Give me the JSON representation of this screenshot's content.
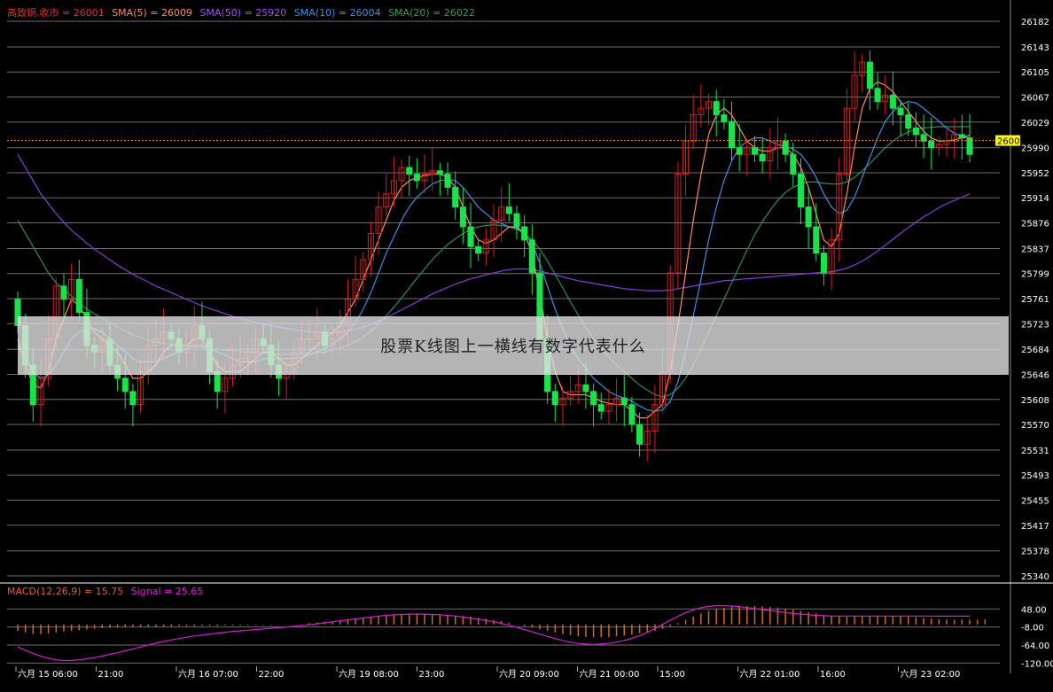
{
  "colors": {
    "background": "#000000",
    "grid": "#6e6e6e",
    "up": "#d42020",
    "down": "#19e34a",
    "sma5": "#ff8c5a",
    "sma10": "#3b8fe6",
    "sma20": "#2a8f5a",
    "sma50": "#8a3ad9",
    "last_price_line": "#ff8c00",
    "macd_hist": "#d2691e",
    "signal": "#d21fd2",
    "last_price_tag_bg": "#ffff00"
  },
  "header": {
    "price_label": "高致铜.收市 = 26001",
    "sma5_label": "SMA(5) = 26009",
    "sma50_label": "SMA(50) = 25920",
    "sma10_label": "SMA(10) = 26004",
    "sma20_label": "SMA(20) = 26022"
  },
  "macd_header": {
    "macd_label": "MACD(12,26,9) = 15.75",
    "signal_label": "Signal = 25.65"
  },
  "banner": {
    "text": "股票K线图上一横线有数字代表什么"
  },
  "chart_data": {
    "type": "candlestick",
    "y_ticks": [
      26182,
      26143,
      26105,
      26067,
      26029,
      25990,
      25952,
      25914,
      25876,
      25837,
      25799,
      25761,
      25723,
      25684,
      25646,
      25608,
      25570,
      25531,
      25493,
      25455,
      25417,
      25378,
      25340
    ],
    "ylim": [
      25340,
      26182
    ],
    "last_price": 26001,
    "x_tick_labels": [
      "六月 15 06:00",
      "21:00",
      "六月 16 07:00",
      "22:00",
      "六月 19 08:00",
      "23:00",
      "六月 20 09:00",
      "六月 21 00:00",
      "15:00",
      "六月 22 01:00",
      "16:00",
      "六月 23 02:00"
    ],
    "closes": [
      25720,
      25660,
      25600,
      25640,
      25700,
      25780,
      25760,
      25790,
      25740,
      25690,
      25680,
      25700,
      25660,
      25640,
      25620,
      25600,
      25650,
      25690,
      25700,
      25710,
      25700,
      25680,
      25690,
      25720,
      25700,
      25650,
      25620,
      25640,
      25660,
      25670,
      25680,
      25700,
      25690,
      25660,
      25640,
      25650,
      25680,
      25700,
      25700,
      25710,
      25690,
      25700,
      25720,
      25760,
      25790,
      25820,
      25860,
      25900,
      25920,
      25940,
      25960,
      25950,
      25940,
      25950,
      25955,
      25950,
      25930,
      25900,
      25870,
      25840,
      25830,
      25850,
      25880,
      25900,
      25890,
      25870,
      25850,
      25800,
      25700,
      25620,
      25600,
      25610,
      25620,
      25630,
      25620,
      25600,
      25590,
      25600,
      25610,
      25600,
      25570,
      25540,
      25560,
      25600,
      25650,
      25800,
      25950,
      26000,
      26040,
      26050,
      26060,
      26040,
      26030,
      25990,
      25980,
      25990,
      25980,
      25970,
      25990,
      26000,
      25980,
      25950,
      25900,
      25870,
      25830,
      25800,
      25850,
      25950,
      26050,
      26100,
      26120,
      26080,
      26060,
      26070,
      26050,
      26040,
      26020,
      26010,
      26000,
      25990,
      25995,
      26000,
      26010,
      26005,
      25980
    ],
    "sma5": [
      25700,
      25660,
      25630,
      25625,
      25650,
      25700,
      25730,
      25760,
      25750,
      25730,
      25710,
      25700,
      25690,
      25680,
      25660,
      25640,
      25640,
      25650,
      25660,
      25680,
      25690,
      25690,
      25690,
      25700,
      25700,
      25680,
      25660,
      25650,
      25650,
      25650,
      25660,
      25670,
      25680,
      25680,
      25670,
      25660,
      25660,
      25670,
      25680,
      25690,
      25700,
      25710,
      25720,
      25740,
      25760,
      25790,
      25820,
      25850,
      25880,
      25910,
      25930,
      25940,
      25945,
      25948,
      25950,
      25950,
      25945,
      25930,
      25900,
      25870,
      25850,
      25845,
      25850,
      25860,
      25870,
      25870,
      25860,
      25830,
      25770,
      25700,
      25650,
      25620,
      25615,
      25615,
      25615,
      25610,
      25605,
      25602,
      25600,
      25600,
      25590,
      25580,
      25580,
      25590,
      25600,
      25650,
      25720,
      25800,
      25880,
      25950,
      26010,
      26040,
      26050,
      26040,
      26020,
      26000,
      25990,
      25985,
      25985,
      25990,
      25990,
      25980,
      25960,
      25930,
      25890,
      25850,
      25840,
      25860,
      25920,
      25990,
      26050,
      26080,
      26090,
      26085,
      26075,
      26060,
      26045,
      26030,
      26015,
      26005,
      26000,
      26000,
      26002,
      26005,
      26009
    ],
    "sma10": [
      25690,
      25670,
      25650,
      25640,
      25645,
      25660,
      25680,
      25700,
      25710,
      25715,
      25715,
      25710,
      25700,
      25690,
      25680,
      25670,
      25665,
      25665,
      25665,
      25670,
      25675,
      25680,
      25685,
      25690,
      25690,
      25685,
      25680,
      25675,
      25670,
      25665,
      25665,
      25665,
      25670,
      25670,
      25670,
      25670,
      25670,
      25672,
      25675,
      25680,
      25685,
      25692,
      25700,
      25710,
      25725,
      25745,
      25770,
      25800,
      25830,
      25855,
      25880,
      25900,
      25915,
      25925,
      25935,
      25940,
      25942,
      25940,
      25930,
      25915,
      25900,
      25890,
      25880,
      25875,
      25870,
      25868,
      25860,
      25845,
      25815,
      25780,
      25745,
      25715,
      25690,
      25670,
      25655,
      25640,
      25630,
      25620,
      25614,
      25610,
      25605,
      25598,
      25592,
      25590,
      25592,
      25605,
      25635,
      25680,
      25735,
      25790,
      25850,
      25900,
      25940,
      25970,
      25990,
      26000,
      26005,
      26005,
      26000,
      25995,
      25992,
      25988,
      25980,
      25965,
      25945,
      25920,
      25900,
      25890,
      25895,
      25915,
      25945,
      25975,
      26005,
      26030,
      26045,
      26055,
      26060,
      26058,
      26050,
      26040,
      26030,
      26020,
      26012,
      26008,
      26004
    ],
    "sma20": [
      25880,
      25860,
      25840,
      25820,
      25800,
      25785,
      25775,
      25765,
      25755,
      25745,
      25738,
      25731,
      25725,
      25718,
      25712,
      25706,
      25702,
      25698,
      25695,
      25693,
      25692,
      25690,
      25689,
      25688,
      25687,
      25685,
      25684,
      25683,
      25682,
      25681,
      25680,
      25679,
      25679,
      25678,
      25677,
      25677,
      25677,
      25677,
      25678,
      25679,
      25680,
      25683,
      25686,
      25690,
      25696,
      25703,
      25712,
      25723,
      25735,
      25748,
      25762,
      25777,
      25792,
      25806,
      25820,
      25832,
      25843,
      25852,
      25860,
      25866,
      25870,
      25872,
      25873,
      25872,
      25870,
      25866,
      25860,
      25850,
      25836,
      25818,
      25798,
      25777,
      25756,
      25736,
      25717,
      25700,
      25685,
      25672,
      25660,
      25650,
      25640,
      25630,
      25622,
      25615,
      25612,
      25615,
      25625,
      25640,
      25660,
      25685,
      25710,
      25735,
      25760,
      25785,
      25810,
      25835,
      25858,
      25878,
      25895,
      25910,
      25922,
      25930,
      25935,
      25938,
      25938,
      25936,
      25935,
      25935,
      25938,
      25945,
      25955,
      25966,
      25978,
      25990,
      26000,
      26008,
      26014,
      26018,
      26020,
      26021,
      26022,
      26022,
      26022,
      26022,
      26022
    ],
    "sma50": [
      25980,
      25960,
      25940,
      25920,
      25905,
      25890,
      25877,
      25865,
      25855,
      25845,
      25836,
      25828,
      25820,
      25812,
      25805,
      25798,
      25792,
      25786,
      25780,
      25775,
      25770,
      25765,
      25760,
      25755,
      25750,
      25746,
      25742,
      25738,
      25734,
      25731,
      25728,
      25725,
      25722,
      25720,
      25718,
      25716,
      25714,
      25712,
      25711,
      25710,
      25709,
      25709,
      25710,
      25712,
      25715,
      25718,
      25722,
      25727,
      25732,
      25738,
      25744,
      25750,
      25756,
      25762,
      25768,
      25773,
      25778,
      25783,
      25787,
      25791,
      25794,
      25797,
      25800,
      25803,
      25805,
      25806,
      25806,
      25805,
      25803,
      25800,
      25797,
      25794,
      25791,
      25788,
      25786,
      25784,
      25782,
      25780,
      25778,
      25776,
      25775,
      25774,
      25773,
      25773,
      25773,
      25774,
      25776,
      25778,
      25780,
      25782,
      25784,
      25786,
      25788,
      25789,
      25790,
      25791,
      25792,
      25793,
      25794,
      25795,
      25796,
      25797,
      25798,
      25799,
      25800,
      25801,
      25802,
      25804,
      25807,
      25812,
      25818,
      25825,
      25833,
      25842,
      25851,
      25860,
      25869,
      25877,
      25885,
      25892,
      25899,
      25905,
      25910,
      25915,
      25920
    ],
    "macd_hist": [
      -20,
      -25,
      -30,
      -30,
      -28,
      -25,
      -22,
      -20,
      -18,
      -16,
      -14,
      -12,
      -11,
      -10,
      -9,
      -8,
      -8,
      -7,
      -7,
      -6,
      -6,
      -5,
      -5,
      -5,
      -4,
      -4,
      -4,
      -3,
      -3,
      -3,
      -3,
      -2,
      -2,
      -2,
      -1,
      -1,
      0,
      2,
      4,
      6,
      8,
      10,
      12,
      15,
      18,
      21,
      24,
      27,
      29,
      31,
      32,
      33,
      33,
      33,
      32,
      31,
      30,
      28,
      26,
      24,
      21,
      18,
      14,
      10,
      5,
      0,
      -5,
      -10,
      -15,
      -20,
      -25,
      -30,
      -34,
      -37,
      -39,
      -40,
      -40,
      -39,
      -37,
      -35,
      -32,
      -28,
      -24,
      -20,
      -14,
      -6,
      4,
      14,
      24,
      34,
      42,
      48,
      52,
      55,
      56,
      57,
      57,
      56,
      54,
      52,
      49,
      46,
      42,
      38,
      34,
      30,
      27,
      25,
      24,
      24,
      25,
      26,
      27,
      27,
      26,
      25,
      24,
      22,
      20,
      18,
      16,
      15,
      15,
      15,
      15,
      15,
      15.75
    ],
    "signal": [
      -70,
      -80,
      -90,
      -98,
      -105,
      -110,
      -112,
      -112,
      -110,
      -107,
      -103,
      -98,
      -93,
      -88,
      -82,
      -76,
      -70,
      -64,
      -58,
      -53,
      -48,
      -44,
      -40,
      -36,
      -33,
      -30,
      -27,
      -24,
      -22,
      -20,
      -18,
      -16,
      -14,
      -12,
      -10,
      -8,
      -6,
      -4,
      -1,
      2,
      5,
      8,
      11,
      14,
      17,
      20,
      23,
      26,
      28,
      30,
      31,
      32,
      32,
      32,
      31,
      30,
      28,
      26,
      23,
      20,
      16,
      12,
      8,
      3,
      -3,
      -9,
      -16,
      -23,
      -30,
      -37,
      -44,
      -50,
      -55,
      -59,
      -61,
      -62,
      -61,
      -59,
      -55,
      -50,
      -43,
      -35,
      -25,
      -13,
      0,
      13,
      25,
      36,
      45,
      52,
      56,
      58,
      58,
      57,
      55,
      52,
      49,
      46,
      43,
      40,
      37,
      34,
      32,
      30,
      28,
      27,
      26,
      26,
      26,
      26,
      26,
      26,
      26,
      26,
      26,
      26,
      26,
      26,
      26,
      25.8,
      25.7,
      25.7,
      25.7,
      25.7,
      25.65
    ],
    "macd_y_ticks": [
      48.0,
      -8.0,
      -64.0,
      -120.0
    ],
    "macd_ylim": [
      -130,
      90
    ]
  }
}
